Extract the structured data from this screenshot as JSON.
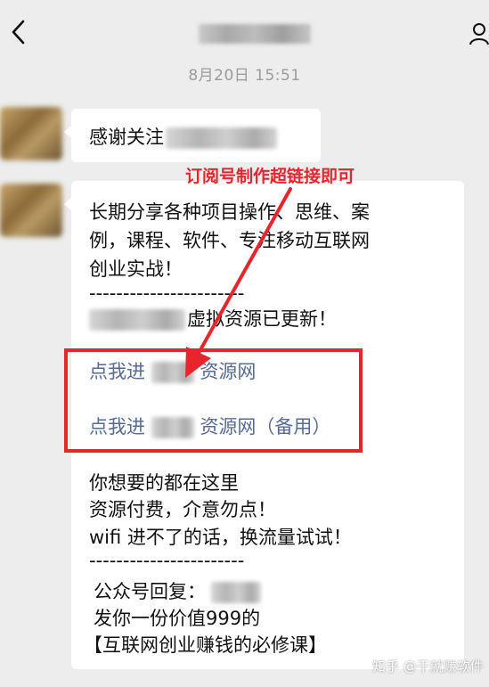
{
  "timestamp": "8月20日 15:51",
  "message1": {
    "text": "感谢关注"
  },
  "annotation": "订阅号制作超链接即可",
  "message2": {
    "intro_line1": "长期分享各种项目操作、思维、案",
    "intro_line2": "例，课程、软件、专注移动互联网",
    "intro_line3": "创业实战！",
    "divider": "-----------------------",
    "updated_text": "虚拟资源已更新！",
    "link1_prefix": "点我进",
    "link1_suffix": "资源网",
    "link2_prefix": "点我进",
    "link2_suffix": "资源网（备用）",
    "line_a": "你想要的都在这里",
    "line_b": "资源付费，介意勿点！",
    "line_c": "wifi 进不了的话，换流量试试！",
    "divider2": "-----------------------",
    "reply_prefix": "公众号回复：",
    "gift_line": "发你一份价值999的",
    "course_line": "【互联网创业赚钱的必修课】"
  },
  "watermark": "知乎 @干就赚软件",
  "colors": {
    "annotation_red": "#e8242d",
    "link_blue": "#576b95"
  }
}
